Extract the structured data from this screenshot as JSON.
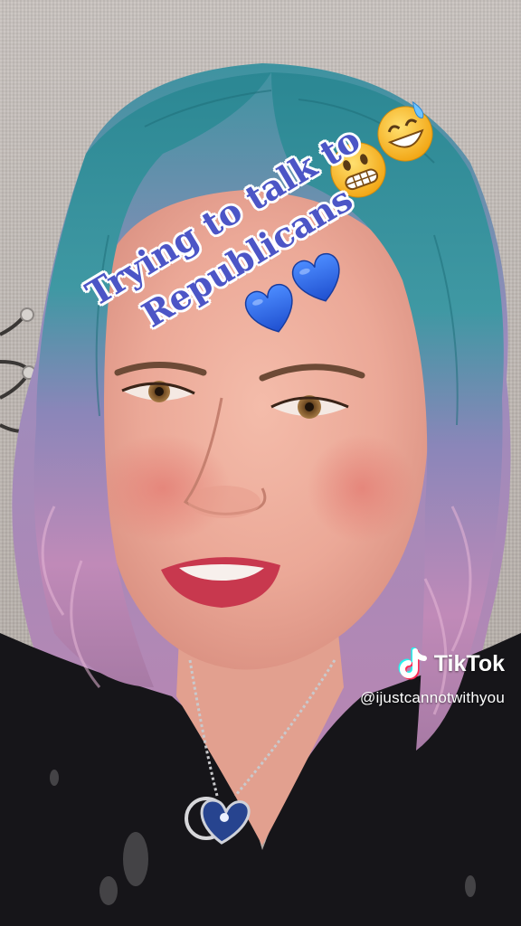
{
  "overlay": {
    "caption_line1": "Trying to talk to",
    "caption_line2": "Republicans"
  },
  "emoji": {
    "grimace": "grimacing-face",
    "sweat": "grinning-face-with-sweat",
    "hearts": "blue-heart"
  },
  "watermark": {
    "brand": "TikTok",
    "handle": "@ijustcannotwithyou"
  },
  "colors": {
    "caption_text": "#4c55c6",
    "caption_outline": "#ffffff",
    "hair_teal": "#2f8c96",
    "hair_pink": "#c48ab6",
    "shirt": "#151518",
    "heart_blue": "#2f6be8"
  }
}
